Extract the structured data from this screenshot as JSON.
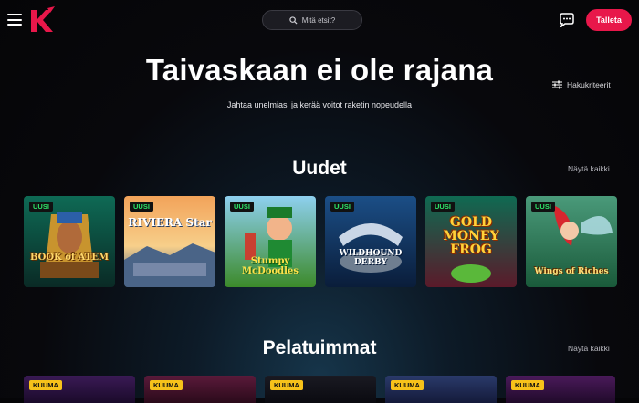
{
  "header": {
    "search_placeholder": "Mitä etsit?",
    "deposit_label": "Talleta",
    "icons": [
      "menu-icon",
      "brand-logo",
      "search-icon",
      "chat-icon"
    ]
  },
  "hero": {
    "title": "Taivaskaan ei ole rajana",
    "subtitle": "Jahtaa unelmiasi ja kerää voitot raketin nopeudella",
    "filters_label": "Hakukriteerit"
  },
  "sections": {
    "new": {
      "title": "Uudet",
      "see_all": "Näytä kaikki",
      "badge": "UUSI",
      "games": [
        {
          "title": "BOOK of ATEM"
        },
        {
          "title": "RIVIERA Star"
        },
        {
          "title": "Stumpy McDoodles"
        },
        {
          "title": "WILDHOUND DERBY"
        },
        {
          "title": "GOLD MONEY FROG"
        },
        {
          "title": "Wings of Riches"
        }
      ]
    },
    "popular": {
      "title": "Pelatuimmat",
      "see_all": "Näytä kaikki",
      "badge": "KUUMA"
    }
  },
  "colors": {
    "accent": "#e8174a",
    "new_badge_text": "#2ee86a",
    "hot_badge_bg": "#f7c21a"
  }
}
